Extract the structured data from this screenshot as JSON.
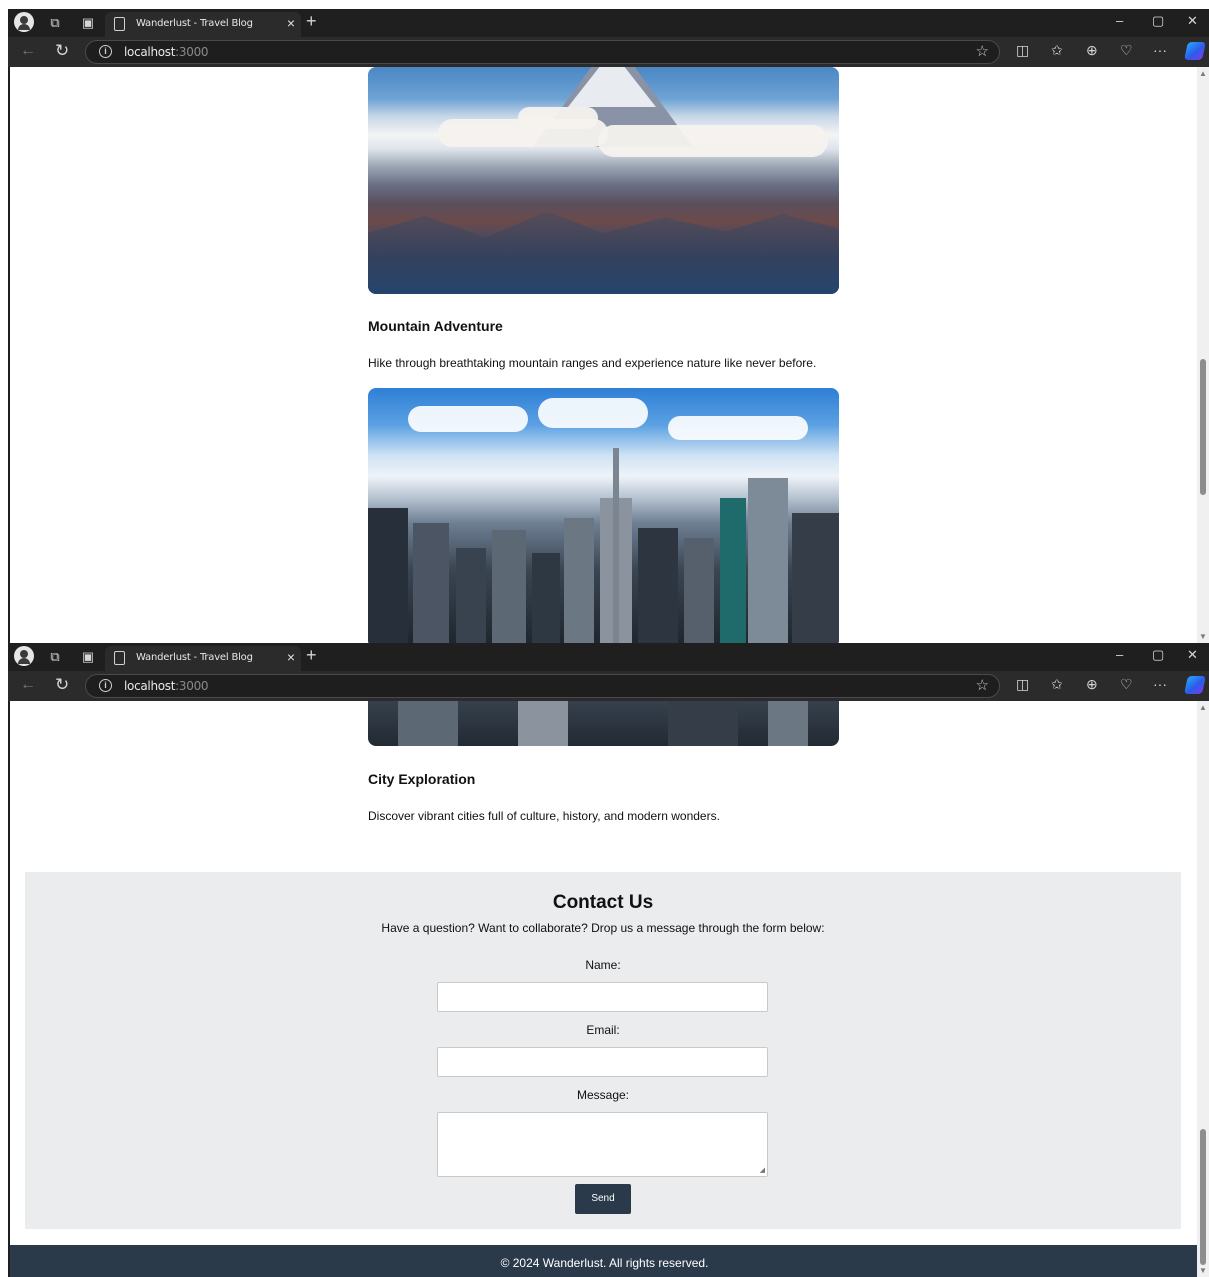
{
  "browser": {
    "tab_title": "Wanderlust - Travel Blog",
    "tab_close": "×",
    "new_tab": "+",
    "url_host": "localhost",
    "url_port": ":3000",
    "window_controls": {
      "minimize": "–",
      "maximize": "▢",
      "close": "✕"
    }
  },
  "posts": [
    {
      "title": "Mountain Adventure",
      "description": "Hike through breathtaking mountain ranges and experience nature like never before."
    },
    {
      "title": "City Exploration",
      "description": "Discover vibrant cities full of culture, history, and modern wonders."
    }
  ],
  "contact": {
    "title": "Contact Us",
    "subtitle": "Have a question? Want to collaborate? Drop us a message through the form below:",
    "name_label": "Name:",
    "email_label": "Email:",
    "message_label": "Message:",
    "name_value": "",
    "email_value": "",
    "message_value": "",
    "send_label": "Send"
  },
  "footer": {
    "text": "© 2024 Wanderlust. All rights reserved."
  },
  "icons": {
    "profile": "profile-icon",
    "workspaces": "workspaces-icon",
    "tab_actions": "tab-actions-icon",
    "back": "←",
    "refresh": "↻",
    "info": "i",
    "favorite": "☆",
    "split_screen": "◫",
    "favorites": "✩",
    "collections": "⊕",
    "browser_essentials": "♡",
    "more": "···"
  },
  "colors": {
    "chrome_dark": "#1f1f1f",
    "toolbar": "#2b2b2b",
    "contact_bg": "#ebeced",
    "accent_navy": "#2b3a4b"
  }
}
